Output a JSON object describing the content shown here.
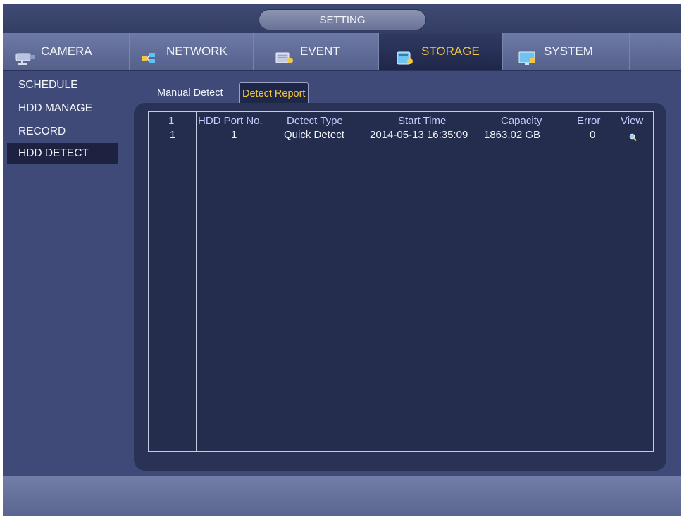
{
  "window": {
    "title": "SETTING"
  },
  "tabs": [
    {
      "label": "CAMERA",
      "icon": "camera-icon",
      "active": false
    },
    {
      "label": "NETWORK",
      "icon": "network-icon",
      "active": false
    },
    {
      "label": "EVENT",
      "icon": "event-icon",
      "active": false
    },
    {
      "label": "STORAGE",
      "icon": "storage-icon",
      "active": true
    },
    {
      "label": "SYSTEM",
      "icon": "system-icon",
      "active": false
    }
  ],
  "sidebar": {
    "items": [
      {
        "label": "SCHEDULE",
        "active": false
      },
      {
        "label": "HDD MANAGE",
        "active": false
      },
      {
        "label": "RECORD",
        "active": false
      },
      {
        "label": "HDD DETECT",
        "active": true
      }
    ]
  },
  "subtabs": [
    {
      "label": "Manual Detect",
      "active": false
    },
    {
      "label": "Detect Report",
      "active": true
    }
  ],
  "table": {
    "columns": [
      "1",
      "HDD Port No.",
      "Detect Type",
      "Start Time",
      "Capacity",
      "Error",
      "View"
    ],
    "rows": [
      {
        "index": "1",
        "port": "1",
        "type": "Quick Detect",
        "start": "2014-05-13 16:35:09",
        "capacity": "1863.02 GB",
        "error": "0",
        "view_icon": "magnifier-icon"
      }
    ]
  },
  "colors": {
    "accent": "#f3c646",
    "header_text": "#c7ccff",
    "background": "#3f4a78"
  }
}
